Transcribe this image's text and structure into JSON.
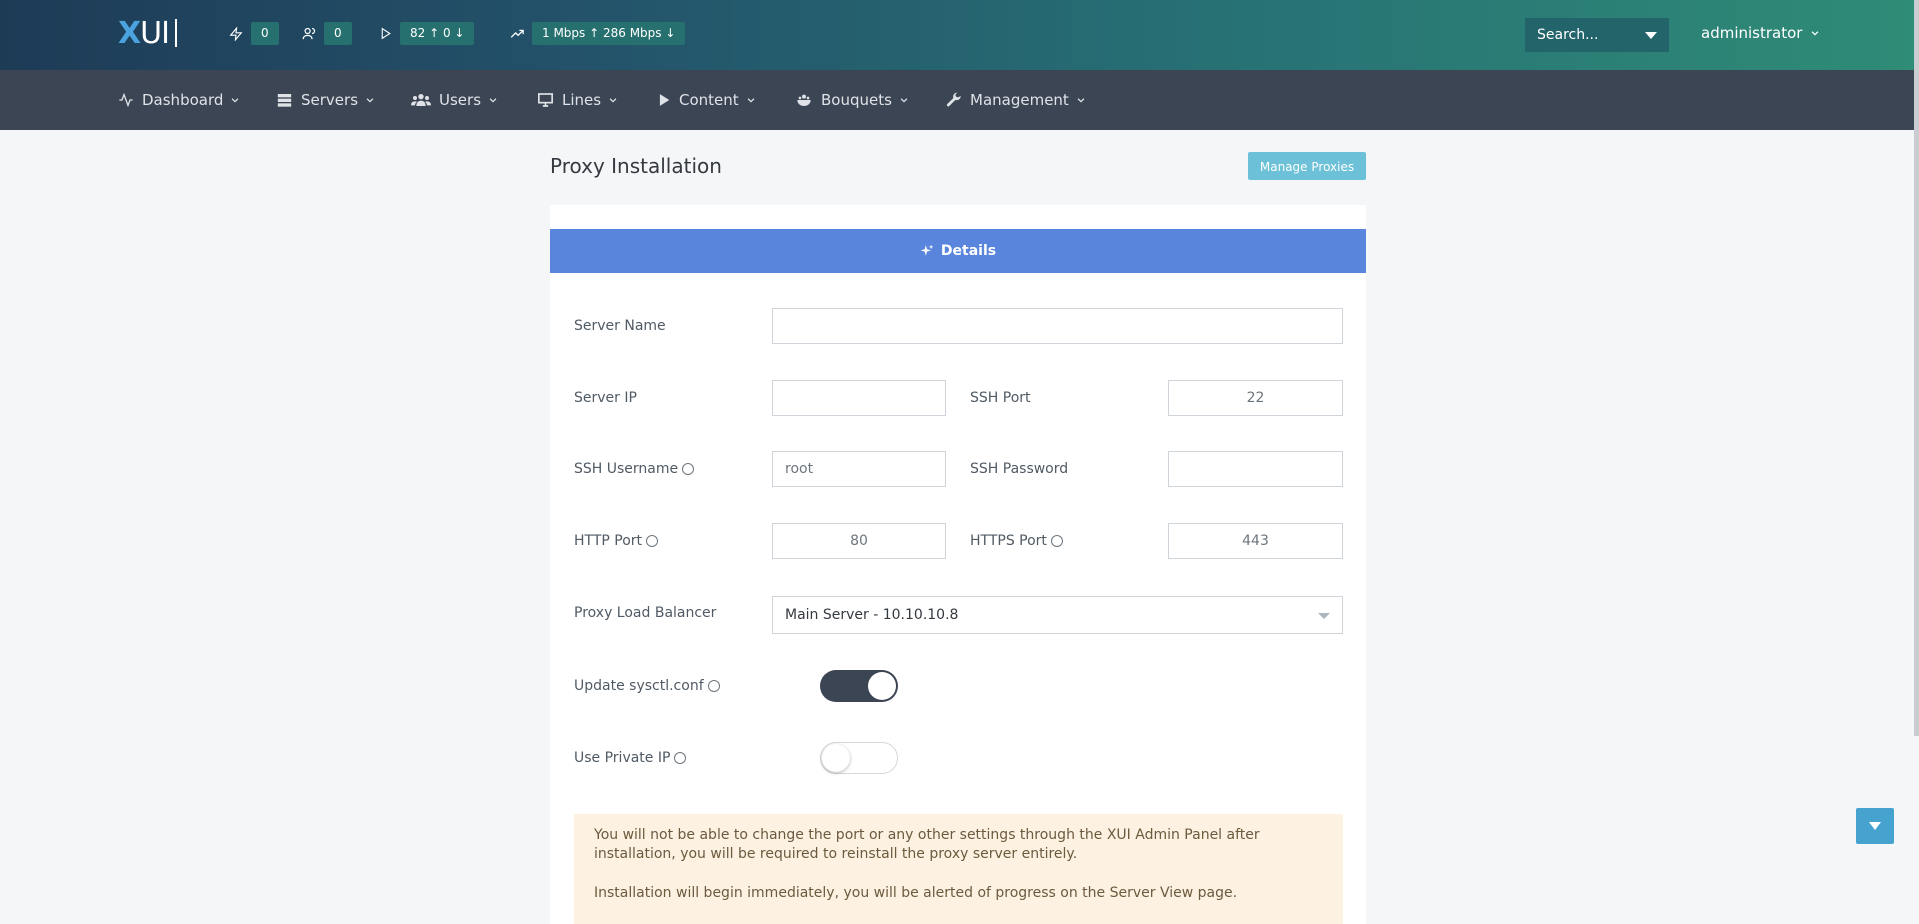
{
  "brand": {
    "logo_x": "X",
    "logo_ui": "UI"
  },
  "topbar": {
    "stats": [
      {
        "icon": "bolt-icon",
        "value": "0"
      },
      {
        "icon": "users-icon",
        "value": "0"
      },
      {
        "icon": "play-icon",
        "value": "82 ↑  0 ↓"
      },
      {
        "icon": "trending-up-icon",
        "value": "1 Mbps ↑  286 Mbps ↓"
      }
    ],
    "search_placeholder": "Search...",
    "user": "administrator"
  },
  "nav": {
    "items": [
      {
        "label": "Dashboard",
        "icon": "activity-icon"
      },
      {
        "label": "Servers",
        "icon": "server-icon"
      },
      {
        "label": "Users",
        "icon": "users-icon"
      },
      {
        "label": "Lines",
        "icon": "monitor-icon"
      },
      {
        "label": "Content",
        "icon": "play-icon"
      },
      {
        "label": "Bouquets",
        "icon": "flower-icon"
      },
      {
        "label": "Management",
        "icon": "wrench-icon"
      }
    ]
  },
  "page": {
    "title": "Proxy Installation",
    "manage_button": "Manage Proxies",
    "tab_label": "Details"
  },
  "form": {
    "server_name": {
      "label": "Server Name",
      "value": ""
    },
    "server_ip": {
      "label": "Server IP",
      "value": ""
    },
    "ssh_port": {
      "label": "SSH Port",
      "value": "22"
    },
    "ssh_username": {
      "label": "SSH Username",
      "value": "root"
    },
    "ssh_password": {
      "label": "SSH Password",
      "value": ""
    },
    "http_port": {
      "label": "HTTP Port",
      "value": "80"
    },
    "https_port": {
      "label": "HTTPS Port",
      "value": "443"
    },
    "load_balancer": {
      "label": "Proxy Load Balancer",
      "value": "Main Server - 10.10.10.8"
    },
    "update_sysctl": {
      "label": "Update sysctl.conf",
      "checked": true
    },
    "use_private_ip": {
      "label": "Use Private IP",
      "checked": false
    }
  },
  "alert": {
    "line1": "You will not be able to change the port or any other settings through the XUI Admin Panel after installation, you will be required to reinstall the proxy server entirely.",
    "line2": "Installation will begin immediately, you will be alerted of progress on the Server View page."
  },
  "colors": {
    "accent": "#5a85dd",
    "info_button": "#6cc1d9",
    "navbar": "#3c4553"
  }
}
